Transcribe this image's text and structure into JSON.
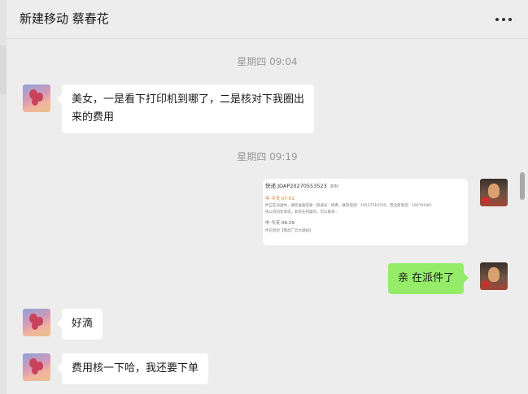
{
  "header": {
    "title": "新建移动 蔡春花"
  },
  "icons": {
    "more": "more-dots-icon",
    "contact_avatar": "balloon-avatar-icon",
    "self_avatar": "fox-avatar-icon"
  },
  "colors": {
    "background": "#ededed",
    "incoming_bubble": "#ffffff",
    "outgoing_bubble": "#95ec69",
    "timestamp_text": "#999999"
  },
  "timestamps": [
    "星期四 09:04",
    "星期四 09:19"
  ],
  "messages": [
    {
      "from": "contact",
      "lines": [
        "美女，一是看下打印机到哪了，二是核对下我圈出",
        "来的费用"
      ]
    },
    {
      "from": "self",
      "type": "image",
      "image_text": {
        "line1": "快递 JDAP20270553523",
        "copy": "复制",
        "line2": "中 今天 07:01",
        "line3": "件正在派送中，请您准备签收（快递员：梅勇，联系电话：19527516705，营业部电话：19079186）",
        "line4": "快公司向您承诺，如有任何疑问，可以联系...",
        "line5": "中 今天 06:29",
        "line6": "件已到达【南昌广云大湖站】"
      }
    },
    {
      "from": "self",
      "lines": [
        "亲 在派件了"
      ]
    },
    {
      "from": "contact",
      "lines": [
        "好滴"
      ]
    },
    {
      "from": "contact",
      "lines": [
        "费用核一下哈，我还要下单"
      ]
    }
  ]
}
